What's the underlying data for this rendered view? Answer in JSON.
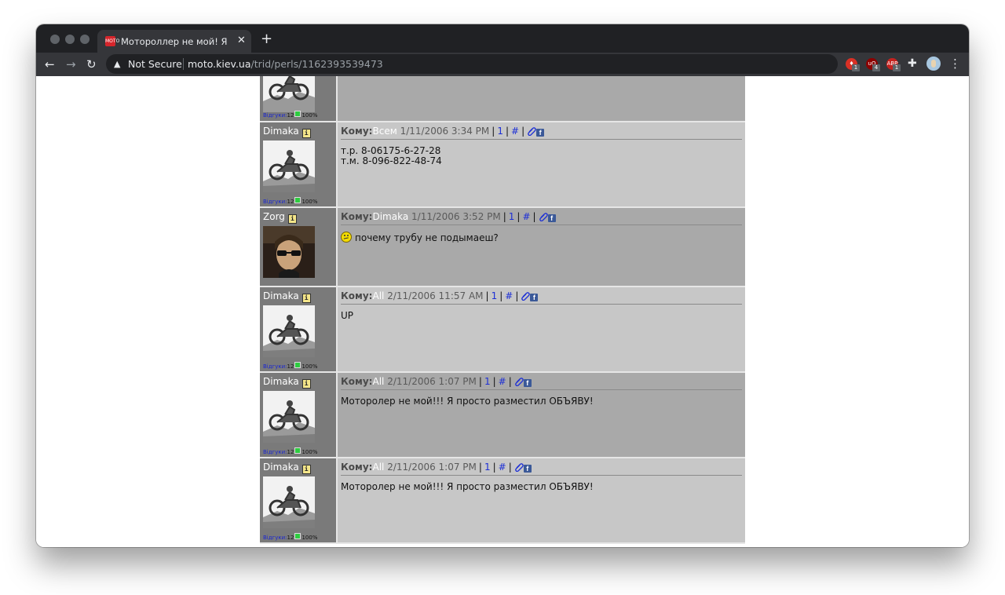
{
  "browser": {
    "tab_title": "Мотороллер не мой! Я прост",
    "favicon_text": "MOTO",
    "close_glyph": "✕",
    "new_tab_glyph": "+",
    "back_glyph": "←",
    "forward_glyph": "→",
    "reload_glyph": "↻",
    "warning_glyph": "▲",
    "security_label": "Not Secure",
    "url_host": "moto.kiev.ua",
    "url_path": "/trid/perls/1162393539473",
    "star_glyph": "☆",
    "extensions": [
      {
        "name": "ext-red-pin",
        "badge": "1",
        "color": "#d93025",
        "glyph": "♦"
      },
      {
        "name": "ublock",
        "badge": "4",
        "color": "#8b0000",
        "glyph": "uO"
      },
      {
        "name": "adblock",
        "badge": "1",
        "color": "#c5221f",
        "glyph": "ABP"
      }
    ],
    "puzzle_glyph": "✚",
    "menu_glyph": "⋮"
  },
  "forum": {
    "info_glyph": "i",
    "rating_label": "Відгуки:",
    "rating_count": "12",
    "rating_percent": "100%",
    "to_label": "Кому:",
    "link_one": "1",
    "link_hash": "#",
    "fb_glyph": "f",
    "partial_post": {
      "show_rating": true
    },
    "posts": [
      {
        "author": "Dimaka",
        "avatar": "moto",
        "to": "Всем",
        "date": "1/11/2006 3:34 PM",
        "text": "т.р. 8-06175-6-27-28\nт.м. 8-096-822-48-74",
        "smiley": false,
        "shade": "light",
        "show_rating": true
      },
      {
        "author": "Zorg",
        "avatar": "photo",
        "to": "Dimaka",
        "date": "1/11/2006 3:52 PM",
        "text": "почему трубу не подымаеш?",
        "smiley": true,
        "shade": "dark",
        "show_rating": false
      },
      {
        "author": "Dimaka",
        "avatar": "moto",
        "to": "All",
        "date": "2/11/2006 11:57 AM",
        "text": "UP",
        "smiley": false,
        "shade": "light",
        "show_rating": true
      },
      {
        "author": "Dimaka",
        "avatar": "moto",
        "to": "All",
        "date": "2/11/2006 1:07 PM",
        "text": "Мотоpолер не мой!!! Я просто разместил ОБЪЯВУ!",
        "smiley": false,
        "shade": "dark",
        "show_rating": true
      },
      {
        "author": "Dimaka",
        "avatar": "moto",
        "to": "All",
        "date": "2/11/2006 1:07 PM",
        "text": "Мотоpолер не мой!!! Я просто разместил ОБЪЯВУ!",
        "smiley": false,
        "shade": "light",
        "show_rating": true
      }
    ]
  }
}
